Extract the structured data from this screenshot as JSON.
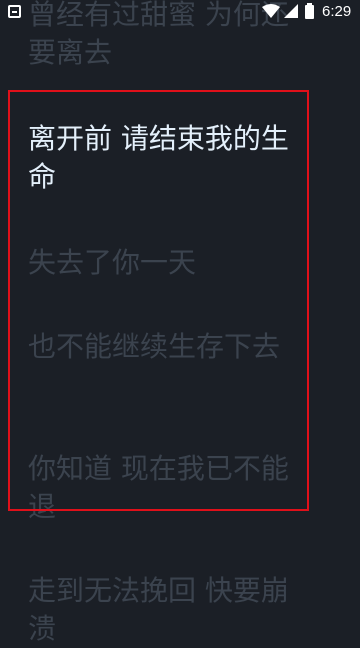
{
  "status_bar": {
    "time": "6:29",
    "icons": [
      "app-icon",
      "wifi-icon",
      "signal-icon",
      "battery-icon"
    ]
  },
  "lyrics": {
    "lines": [
      "曾经有过甜蜜 为何还要离去",
      "离开前 请结束我的生命",
      "失去了你一天",
      "也不能继续生存下去",
      "你知道 现在我已不能退",
      "走到无法挽回 快要崩溃"
    ],
    "active_index": 1
  },
  "colors": {
    "background": "#1b1f26",
    "active_text": "#e4f0fb",
    "inactive_text": "#3b434e",
    "highlight_border": "#e0101a"
  }
}
